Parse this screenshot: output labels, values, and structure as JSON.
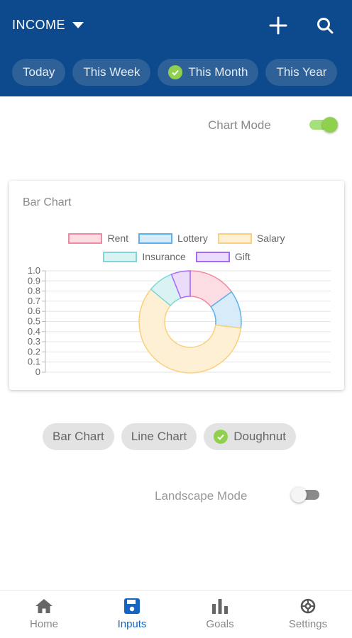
{
  "header": {
    "title": "INCOME",
    "add_icon": "plus-icon",
    "search_icon": "search-icon",
    "periods": [
      {
        "label": "Today",
        "selected": false
      },
      {
        "label": "This Week",
        "selected": false
      },
      {
        "label": "This Month",
        "selected": true
      },
      {
        "label": "This Year",
        "selected": false
      }
    ]
  },
  "chart_mode": {
    "label": "Chart Mode",
    "on": true
  },
  "card": {
    "title": "Bar Chart"
  },
  "chart_data": {
    "type": "pie",
    "title": "Bar Chart",
    "categories": [
      "Rent",
      "Lottery",
      "Salary",
      "Insurance",
      "Gift"
    ],
    "values": [
      15,
      12,
      59,
      8,
      6
    ],
    "colors": {
      "border": [
        "#f08aa0",
        "#5ab1ef",
        "#fbd07d",
        "#7ed6d6",
        "#a66bf5"
      ],
      "fill": [
        "#fddde4",
        "#d8ebf9",
        "#fef0d4",
        "#daf2f2",
        "#ebdcfc"
      ]
    },
    "inner_radius_fraction": 0.5,
    "yaxis_ticks": [
      "1.0",
      "0.9",
      "0.8",
      "0.7",
      "0.6",
      "0.5",
      "0.4",
      "0.3",
      "0.2",
      "0.1",
      "0"
    ],
    "legend_position": "top",
    "grid": true
  },
  "chart_types": [
    {
      "label": "Bar Chart",
      "selected": false
    },
    {
      "label": "Line Chart",
      "selected": false
    },
    {
      "label": "Doughnut",
      "selected": true
    }
  ],
  "landscape_mode": {
    "label": "Landscape Mode",
    "on": false
  },
  "nav": [
    {
      "label": "Home",
      "icon": "home-icon",
      "active": false
    },
    {
      "label": "Inputs",
      "icon": "save-icon",
      "active": true
    },
    {
      "label": "Goals",
      "icon": "bar-chart-icon",
      "active": false
    },
    {
      "label": "Settings",
      "icon": "gear-icon",
      "active": false
    }
  ],
  "colors": {
    "header": "#0d4a8d",
    "chip": "#2e6198",
    "accent_green": "#8fd14f",
    "nav_active": "#1565c0"
  }
}
